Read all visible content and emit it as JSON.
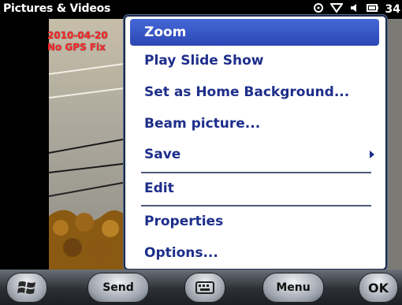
{
  "titlebar": {
    "app_title": "Pictures & Videos",
    "time": "34"
  },
  "photo": {
    "date_stamp": "2010-04-20",
    "gps_status": "No GPS Fix"
  },
  "menu": {
    "items": [
      {
        "label": "Zoom",
        "selected": true
      },
      {
        "label": "Play Slide Show"
      },
      {
        "label": "Set as Home Background..."
      },
      {
        "label": "Beam picture..."
      },
      {
        "label": "Save",
        "has_submenu": true
      },
      {
        "label": "Edit"
      },
      {
        "label": "Properties"
      },
      {
        "label": "Options..."
      }
    ]
  },
  "softkeys": {
    "start_icon": "windows-logo-icon",
    "send_label": "Send",
    "keyboard_icon": "keyboard-icon",
    "menu_label": "Menu",
    "ok_label": "OK"
  },
  "colors": {
    "menu_text": "#1d2e8a",
    "selection": "#3a58c8",
    "overlay_text": "#ff2a2a"
  }
}
